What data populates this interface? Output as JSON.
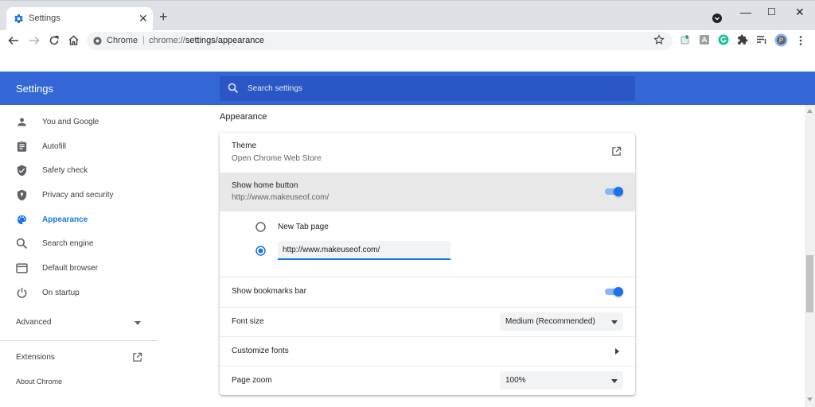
{
  "tab": {
    "title": "Settings",
    "close": "✕",
    "new_tab": "+"
  },
  "window": {
    "minimize": "—",
    "maximize": "☐",
    "close": "✕"
  },
  "omnibox": {
    "site": "Chrome",
    "separator": "|",
    "url_scheme": "chrome://",
    "url_path": "settings/appearance"
  },
  "header": {
    "title": "Settings",
    "search_placeholder": "Search settings"
  },
  "sidebar": {
    "items": [
      {
        "label": "You and Google",
        "icon": "person-icon"
      },
      {
        "label": "Autofill",
        "icon": "clipboard-icon"
      },
      {
        "label": "Safety check",
        "icon": "shield-check-icon"
      },
      {
        "label": "Privacy and security",
        "icon": "shield-lock-icon"
      },
      {
        "label": "Appearance",
        "icon": "palette-icon",
        "active": true
      },
      {
        "label": "Search engine",
        "icon": "search-icon"
      },
      {
        "label": "Default browser",
        "icon": "browser-icon"
      },
      {
        "label": "On startup",
        "icon": "power-icon"
      }
    ],
    "advanced": "Advanced",
    "extensions": "Extensions",
    "about": "About Chrome"
  },
  "appearance": {
    "section_title": "Appearance",
    "theme": {
      "label": "Theme",
      "sub": "Open Chrome Web Store"
    },
    "home_button": {
      "label": "Show home button",
      "sub": "http://www.makeuseof.com/",
      "enabled": true
    },
    "home_options": {
      "new_tab": "New Tab page",
      "custom_url": "http://www.makeuseof.com/",
      "selected": "custom"
    },
    "bookmarks_bar": {
      "label": "Show bookmarks bar",
      "enabled": true
    },
    "font_size": {
      "label": "Font size",
      "value": "Medium (Recommended)"
    },
    "customize_fonts": {
      "label": "Customize fonts"
    },
    "page_zoom": {
      "label": "Page zoom",
      "value": "100%"
    }
  },
  "colors": {
    "accent": "#1a73e8",
    "header": "#3367d6",
    "search": "#2a56c6"
  }
}
